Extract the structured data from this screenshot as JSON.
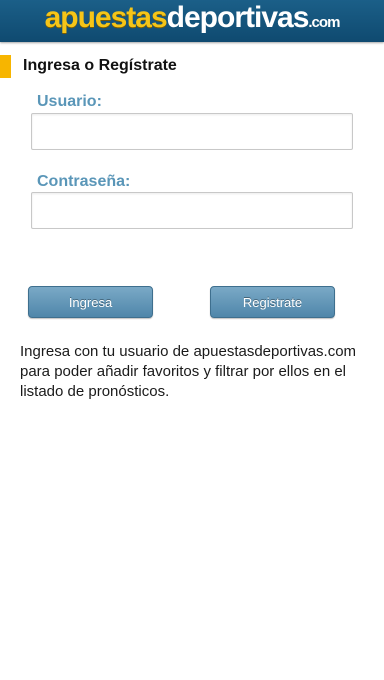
{
  "header": {
    "logo_part1": "apuestas",
    "logo_part2": "deportivas",
    "logo_part3": ".com"
  },
  "section": {
    "title": "Ingresa o Regístrate"
  },
  "form": {
    "username_label": "Usuario:",
    "username_value": "",
    "password_label": "Contraseña:",
    "password_value": ""
  },
  "buttons": {
    "login_label": "Ingresa",
    "register_label": "Registrate"
  },
  "info": {
    "text": "Ingresa con tu usuario de apuestasdeportivas.com para poder añadir favoritos y filtrar por ellos en el listado de pronósticos."
  },
  "colors": {
    "header_bg": "#155682",
    "accent_yellow": "#f7b500",
    "label_blue": "#5a96b8",
    "button_blue": "#5f93b6"
  }
}
